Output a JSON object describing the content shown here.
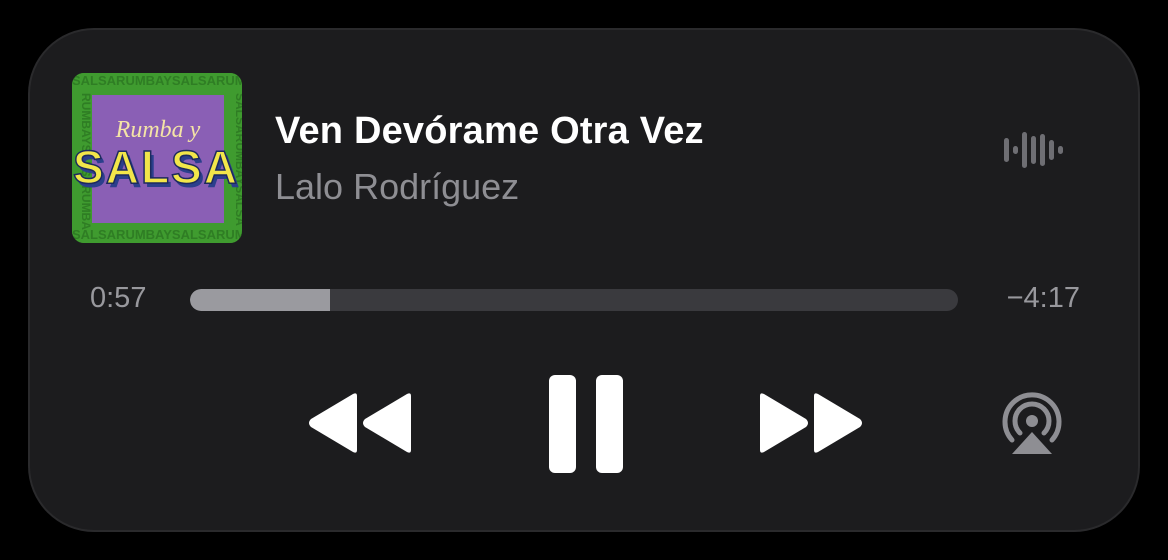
{
  "track": {
    "title": "Ven Devórame Otra Vez",
    "artist": "Lalo Rodríguez"
  },
  "artwork": {
    "line1": "Rumba y",
    "line2": "SALSA",
    "background_color": "#3f9b2f",
    "panel_color": "#8a5fb5"
  },
  "progress": {
    "elapsed": "0:57",
    "remaining": "−4:17",
    "fraction": 0.182
  },
  "controls": {
    "rewind_icon": "rewind-icon",
    "pause_icon": "pause-icon",
    "forward_icon": "fast-forward-icon",
    "airplay_icon": "airplay-audio-icon",
    "waveform_icon": "audio-waveform-icon"
  },
  "colors": {
    "background": "#1c1c1e",
    "title": "#ffffff",
    "secondary": "#8e8e93",
    "track": "#3a3a3e",
    "fill": "#9a9a9f"
  }
}
